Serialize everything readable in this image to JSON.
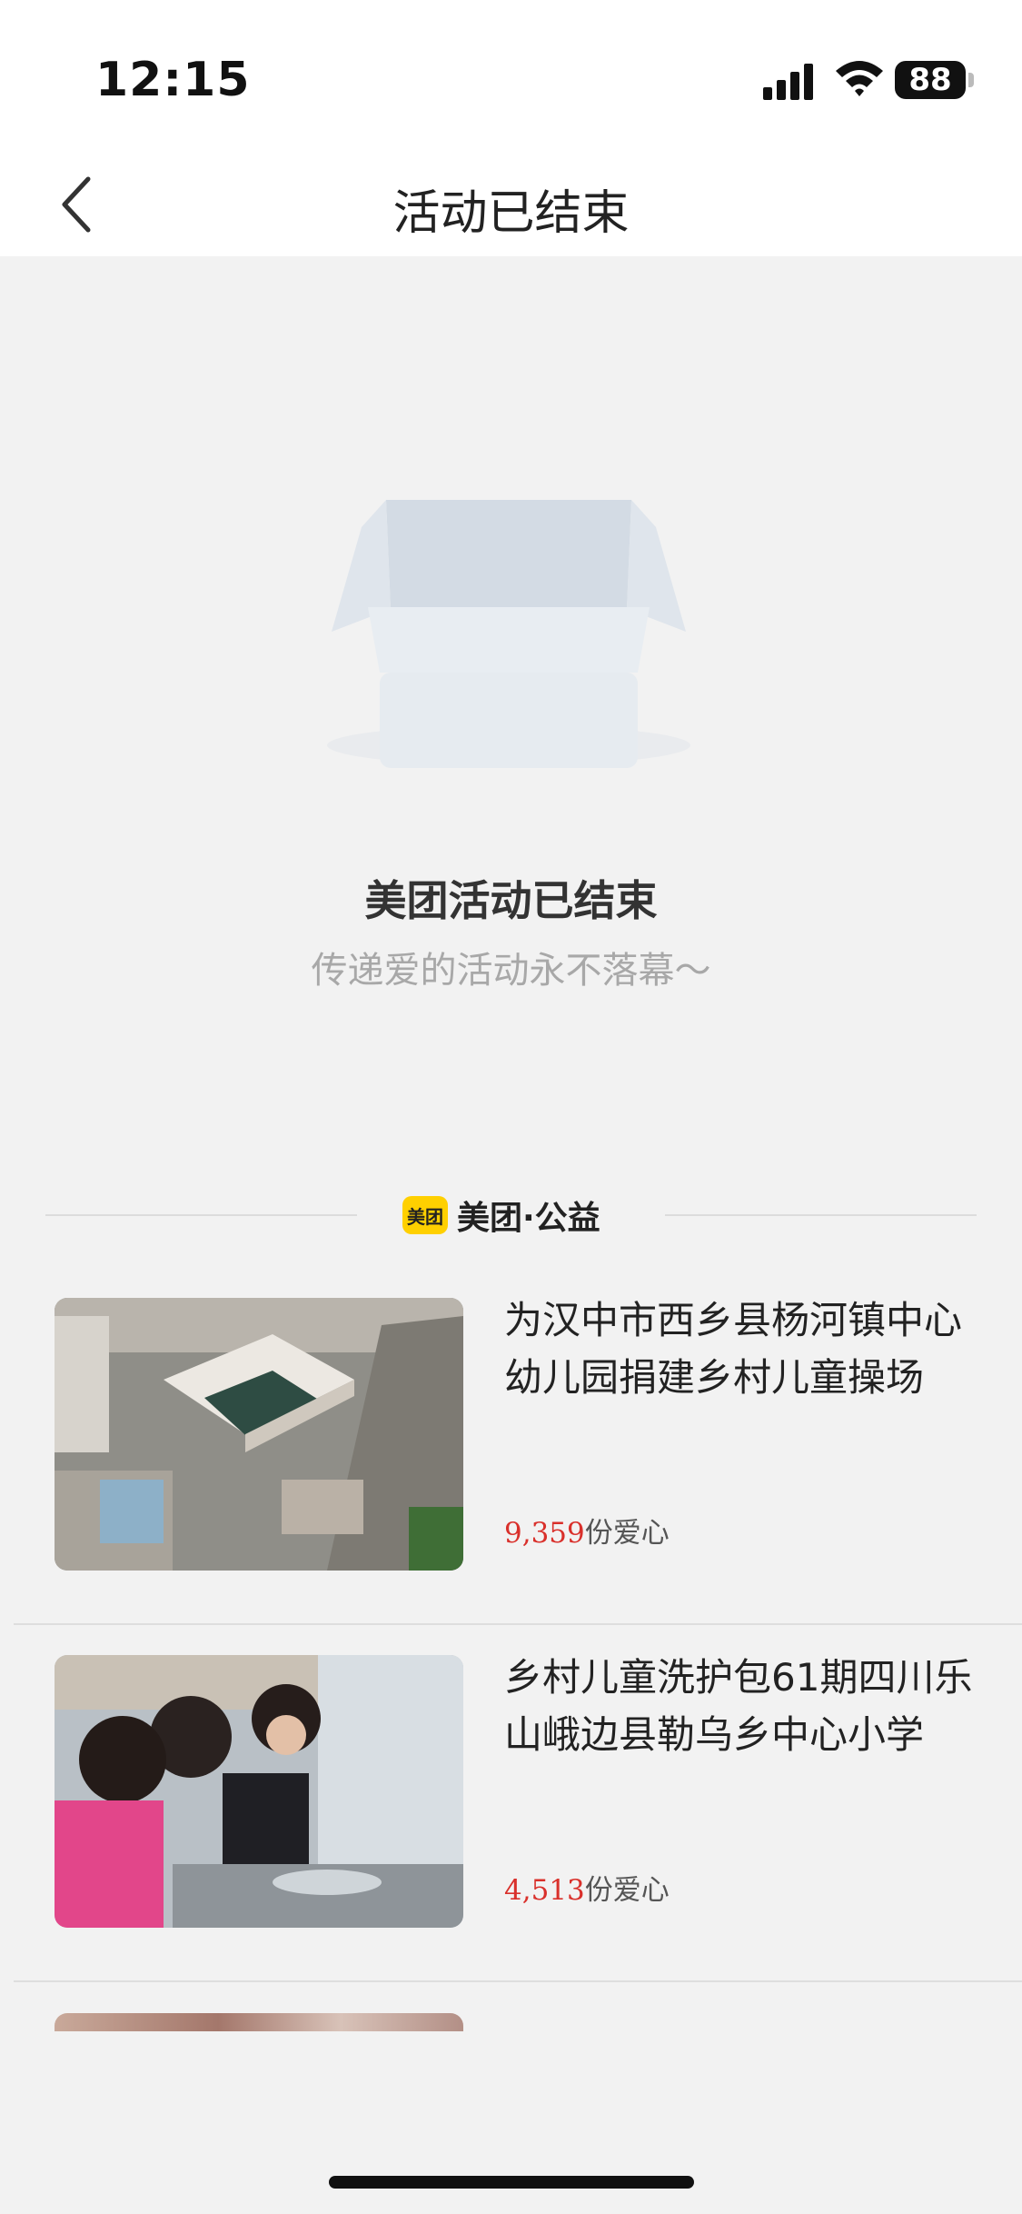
{
  "status_bar": {
    "time": "12:15",
    "battery": "88",
    "icons": [
      "signal-icon",
      "wifi-icon",
      "battery-icon"
    ]
  },
  "nav": {
    "title": "活动已结束",
    "back_icon": "chevron-left-icon"
  },
  "empty_state": {
    "icon": "open-box-icon",
    "title": "美团活动已结束",
    "subtitle": "传递爱的活动永不落幕～"
  },
  "brand": {
    "logo_text": "美团",
    "name": "美团·公益",
    "color": "#ffd000"
  },
  "projects": [
    {
      "title": "为汉中市西乡县杨河镇中心幼儿园捐建乡村儿童操场",
      "count": "9,359",
      "unit": "份爱心",
      "image": "aerial-school-photo"
    },
    {
      "title": "乡村儿童洗护包61期四川乐山峨边县勒乌乡中心小学",
      "count": "4,513",
      "unit": "份爱心",
      "image": "children-washing-photo"
    }
  ],
  "colors": {
    "accent_red": "#d9302b",
    "background": "#f2f2f2"
  }
}
